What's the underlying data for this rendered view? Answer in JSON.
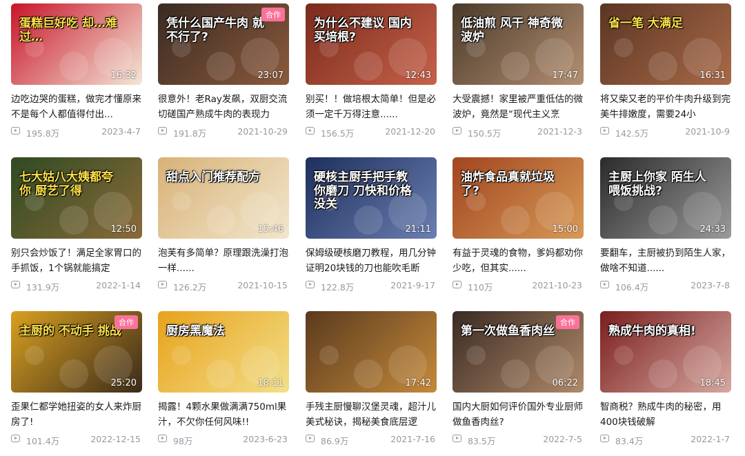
{
  "videos": [
    {
      "caption": "蛋糕巨好吃 却…难过…",
      "caption_color": "yellow",
      "duration": "16:32",
      "badge": "",
      "title": "边吃边哭的蛋糕，做完才懂原来不是每个人都值得付出...",
      "views": "195.8万",
      "date": "2023-4-7",
      "bg": [
        "#c9142a",
        "#f3e7d6"
      ]
    },
    {
      "caption": "凭什么国产牛肉 就不行了?",
      "caption_color": "white",
      "duration": "23:07",
      "badge": "合作",
      "title": "很意外！老Ray发飙，双厨交流切磋国产熟成牛肉的表现力",
      "views": "191.8万",
      "date": "2021-10-29",
      "bg": [
        "#3a2a22",
        "#8b5a3c"
      ]
    },
    {
      "caption": "为什么不建议 国内买培根?",
      "caption_color": "white",
      "duration": "12:43",
      "badge": "",
      "title": "别买！！做培根太简单！但是必须一定千万得注意......",
      "views": "156.5万",
      "date": "2021-12-20",
      "bg": [
        "#7a2a1c",
        "#c6624a"
      ]
    },
    {
      "caption": "低油煎 风干 神奇微波炉",
      "caption_color": "white",
      "duration": "17:47",
      "badge": "",
      "title": "大受震撼！家里被严重低估的微波炉，竟然是“现代主义烹",
      "views": "150.5万",
      "date": "2021-12-3",
      "bg": [
        "#4a3a2a",
        "#b59072"
      ]
    },
    {
      "caption": "省一笔 大满足",
      "caption_color": "yellow",
      "duration": "16:31",
      "badge": "",
      "title": "将又柴又老的平价牛肉升级到完美牛排嫩度，需要24小",
      "views": "142.5万",
      "date": "2021-10-9",
      "bg": [
        "#5b3523",
        "#a86a48"
      ]
    },
    {
      "caption": "七大姑八大姨都夸你 厨艺了得",
      "caption_color": "yellow",
      "duration": "12:50",
      "badge": "",
      "title": "别只会炒饭了！满足全家胃口的手抓饭，1个锅就能搞定",
      "views": "131.9万",
      "date": "2022-1-14",
      "bg": [
        "#2f4a22",
        "#8a6b3a"
      ]
    },
    {
      "caption": "甜点入门推荐配方",
      "caption_color": "white",
      "duration": "15:46",
      "badge": "",
      "title": "泡芙有多简单？原理跟洗澡打泡一样......",
      "views": "126.2万",
      "date": "2021-10-15",
      "bg": [
        "#d8b277",
        "#f2e6cd"
      ]
    },
    {
      "caption": "硬核主厨手把手教你磨刀 刀快和价格没关",
      "caption_color": "white",
      "duration": "21:11",
      "badge": "",
      "title": "保姆级硬核磨刀教程，用几分钟证明20块钱的刀也能吹毛断",
      "views": "122.8万",
      "date": "2021-9-17",
      "bg": [
        "#1d2f5c",
        "#6b7fb2"
      ]
    },
    {
      "caption": "油炸食品真就垃圾了?",
      "caption_color": "white",
      "duration": "15:00",
      "badge": "",
      "title": "有益于灵魂的食物，爹妈都劝你少吃，但其实......",
      "views": "110万",
      "date": "2021-10-23",
      "bg": [
        "#a2451f",
        "#d79a57"
      ]
    },
    {
      "caption": "主厨上你家 陌生人喂饭挑战?",
      "caption_color": "white",
      "duration": "24:33",
      "badge": "",
      "title": "要翻车，主厨被扔到陌生人家，做啥不知道......",
      "views": "106.4万",
      "date": "2023-7-8",
      "bg": [
        "#2b2b2b",
        "#9a9a9a"
      ]
    },
    {
      "caption": "主厨的 不动手 挑战",
      "caption_color": "yellow",
      "duration": "25:20",
      "badge": "合作",
      "title": "歪果仁都学她扭姿的女人来炸厨房了!",
      "views": "101.4万",
      "date": "2022-12-15",
      "bg": [
        "#d9a020",
        "#3a2a1a"
      ]
    },
    {
      "caption": "厨房黑魔法",
      "caption_color": "white",
      "duration": "18:11",
      "badge": "",
      "title": "揭露！4颗水果做满满750ml果汁，不欠你任何风味!!",
      "views": "98万",
      "date": "2023-6-23",
      "bg": [
        "#e8a21c",
        "#f2df8a"
      ]
    },
    {
      "caption": "",
      "caption_color": "white",
      "duration": "17:42",
      "badge": "",
      "title": "手残主厨慢聊汉堡灵魂，超汁儿美式秘诀，揭秘美食底层逻",
      "views": "86.9万",
      "date": "2021-7-16",
      "bg": [
        "#5a3a1e",
        "#c58a3a"
      ]
    },
    {
      "caption": "第一次做鱼香肉丝",
      "caption_color": "white",
      "duration": "06:22",
      "badge": "合作",
      "title": "国内大厨如何评价国外专业厨师做鱼香肉丝?",
      "views": "83.5万",
      "date": "2022-7-5",
      "bg": [
        "#3a2a22",
        "#b08a6a"
      ]
    },
    {
      "caption": "熟成牛肉的真相!",
      "caption_color": "white",
      "duration": "18:45",
      "badge": "",
      "title": "智商税？熟成牛肉的秘密，用400块钱破解",
      "views": "83.4万",
      "date": "2022-1-7",
      "bg": [
        "#7a1e1e",
        "#d6a8a0"
      ]
    }
  ]
}
